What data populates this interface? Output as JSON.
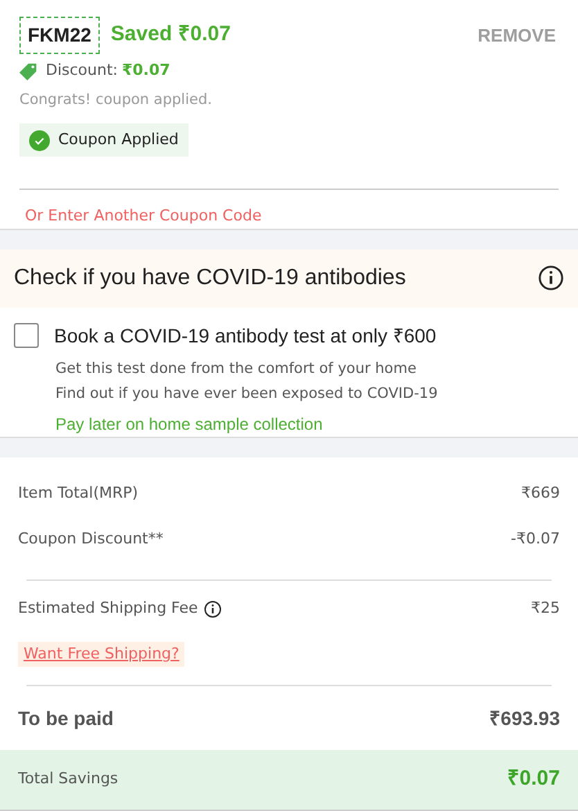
{
  "coupon": {
    "code": "FKM22",
    "saved": "Saved ₹0.07",
    "remove": "REMOVE",
    "discount_label": "Discount:",
    "discount_value": "₹0.07",
    "message": "Congrats! coupon applied.",
    "status": "Coupon Applied",
    "another": "Or Enter Another Coupon Code"
  },
  "covid": {
    "title": "Check if you have COVID-19 antibodies",
    "option": {
      "label": "Book a COVID-19 antibody test at only ₹600",
      "checked": false
    },
    "lines": [
      "Get this test done from the comfort of your home",
      "Find out if you have ever been exposed to COVID-19"
    ],
    "pay_later": "Pay later on home sample collection"
  },
  "summary": {
    "rows": [
      {
        "kind": "plain",
        "label": "Item Total(MRP)",
        "value": "₹669"
      },
      {
        "kind": "plain",
        "label": "Coupon Discount**",
        "value": "-₹0.07"
      },
      {
        "kind": "divider"
      },
      {
        "kind": "info",
        "label": "Estimated Shipping Fee",
        "value": "₹25"
      },
      {
        "kind": "link",
        "label": "Want Free Shipping?"
      },
      {
        "kind": "divider"
      },
      {
        "kind": "total",
        "label": "To be paid",
        "value": "₹693.93"
      }
    ],
    "savings": {
      "label": "Total Savings",
      "value": "₹0.07"
    }
  }
}
